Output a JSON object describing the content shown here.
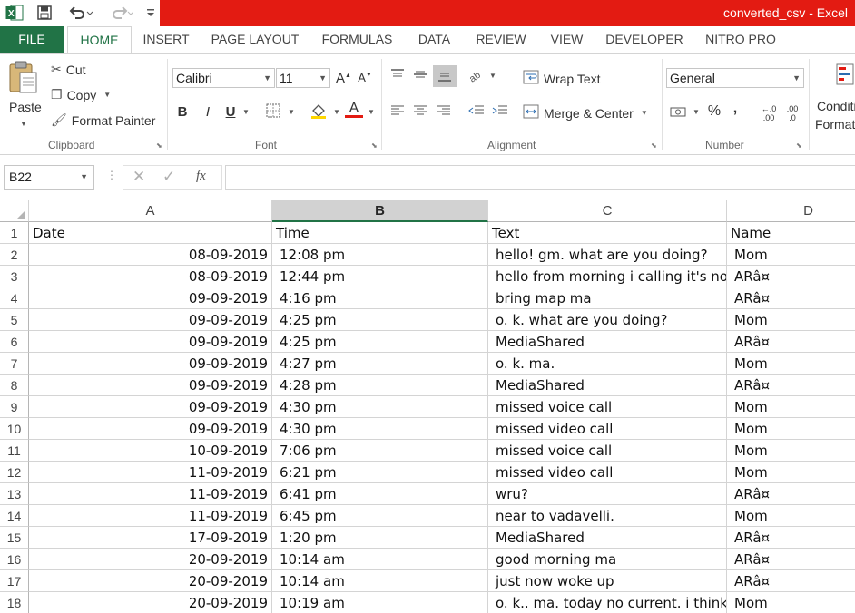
{
  "window": {
    "title": "converted_csv -  Excel"
  },
  "qat": {
    "icons": [
      "excel-logo-icon",
      "save-icon",
      "undo-icon",
      "redo-icon",
      "customize-qat-icon"
    ]
  },
  "tabs": [
    "FILE",
    "HOME",
    "INSERT",
    "PAGE LAYOUT",
    "FORMULAS",
    "DATA",
    "REVIEW",
    "VIEW",
    "DEVELOPER",
    "NITRO PRO"
  ],
  "active_tab": "HOME",
  "ribbon": {
    "clipboard": {
      "paste": "Paste",
      "cut": "Cut",
      "copy": "Copy",
      "format_painter": "Format Painter",
      "label": "Clipboard"
    },
    "font": {
      "name": "Calibri",
      "size": "11",
      "label": "Font",
      "bold": "B",
      "italic": "I",
      "underline": "U",
      "font_color_letter": "A",
      "increase": "A",
      "decrease": "A"
    },
    "alignment": {
      "wrap_text": "Wrap Text",
      "merge_center": "Merge & Center",
      "label": "Alignment"
    },
    "number": {
      "format": "General",
      "label": "Number",
      "percent": "%",
      "comma": ",",
      "inc_dec": ".00",
      "dec_dec": ".0"
    },
    "styles": {
      "cond_format_1": "Conditi",
      "cond_format_2": "Format"
    }
  },
  "formula_bar": {
    "name_box": "B22",
    "fx": "fx",
    "value": ""
  },
  "columns": [
    "A",
    "B",
    "C",
    "D"
  ],
  "selected_column": "B",
  "rows": [
    {
      "n": "1",
      "a": "Date",
      "b": "Time",
      "c": "Text",
      "d": "Name"
    },
    {
      "n": "2",
      "a": "08-09-2019",
      "b": "12:08 pm",
      "c": "hello! gm. what are you doing?",
      "d": "Mom"
    },
    {
      "n": "3",
      "a": "08-09-2019",
      "b": "12:44 pm",
      "c": "hello from morning i calling it's not",
      "d": "ARâ¤"
    },
    {
      "n": "4",
      "a": "09-09-2019",
      "b": "4:16 pm",
      "c": "bring map ma",
      "d": "ARâ¤"
    },
    {
      "n": "5",
      "a": "09-09-2019",
      "b": "4:25 pm",
      "c": "o. k. what are you doing?",
      "d": "Mom"
    },
    {
      "n": "6",
      "a": "09-09-2019",
      "b": "4:25 pm",
      "c": "MediaShared",
      "d": "ARâ¤"
    },
    {
      "n": "7",
      "a": "09-09-2019",
      "b": "4:27 pm",
      "c": "o. k. ma.",
      "d": "Mom"
    },
    {
      "n": "8",
      "a": "09-09-2019",
      "b": "4:28 pm",
      "c": "MediaShared",
      "d": "ARâ¤"
    },
    {
      "n": "9",
      "a": "09-09-2019",
      "b": "4:30 pm",
      "c": "missed voice call",
      "d": "Mom"
    },
    {
      "n": "10",
      "a": "09-09-2019",
      "b": "4:30 pm",
      "c": "missed video call",
      "d": "Mom"
    },
    {
      "n": "11",
      "a": "10-09-2019",
      "b": "7:06 pm",
      "c": "missed voice call",
      "d": "Mom"
    },
    {
      "n": "12",
      "a": "11-09-2019",
      "b": "6:21 pm",
      "c": "missed video call",
      "d": "Mom"
    },
    {
      "n": "13",
      "a": "11-09-2019",
      "b": "6:41 pm",
      "c": "wru?",
      "d": "ARâ¤"
    },
    {
      "n": "14",
      "a": "11-09-2019",
      "b": "6:45 pm",
      "c": "near to vadavelli.",
      "d": "Mom"
    },
    {
      "n": "15",
      "a": "17-09-2019",
      "b": "1:20 pm",
      "c": "MediaShared",
      "d": "ARâ¤"
    },
    {
      "n": "16",
      "a": "20-09-2019",
      "b": "10:14 am",
      "c": "good morning ma",
      "d": "ARâ¤"
    },
    {
      "n": "17",
      "a": "20-09-2019",
      "b": "10:14 am",
      "c": "just now woke up",
      "d": "ARâ¤"
    },
    {
      "n": "18",
      "a": "20-09-2019",
      "b": "10:19 am",
      "c": "o. k.. ma. today no current. i think i",
      "d": "Mom"
    }
  ],
  "colors": {
    "excel_green": "#217346",
    "title_red": "#e31b12",
    "font_color_red": "#e31b12",
    "fill_yellow": "#ffd700"
  }
}
